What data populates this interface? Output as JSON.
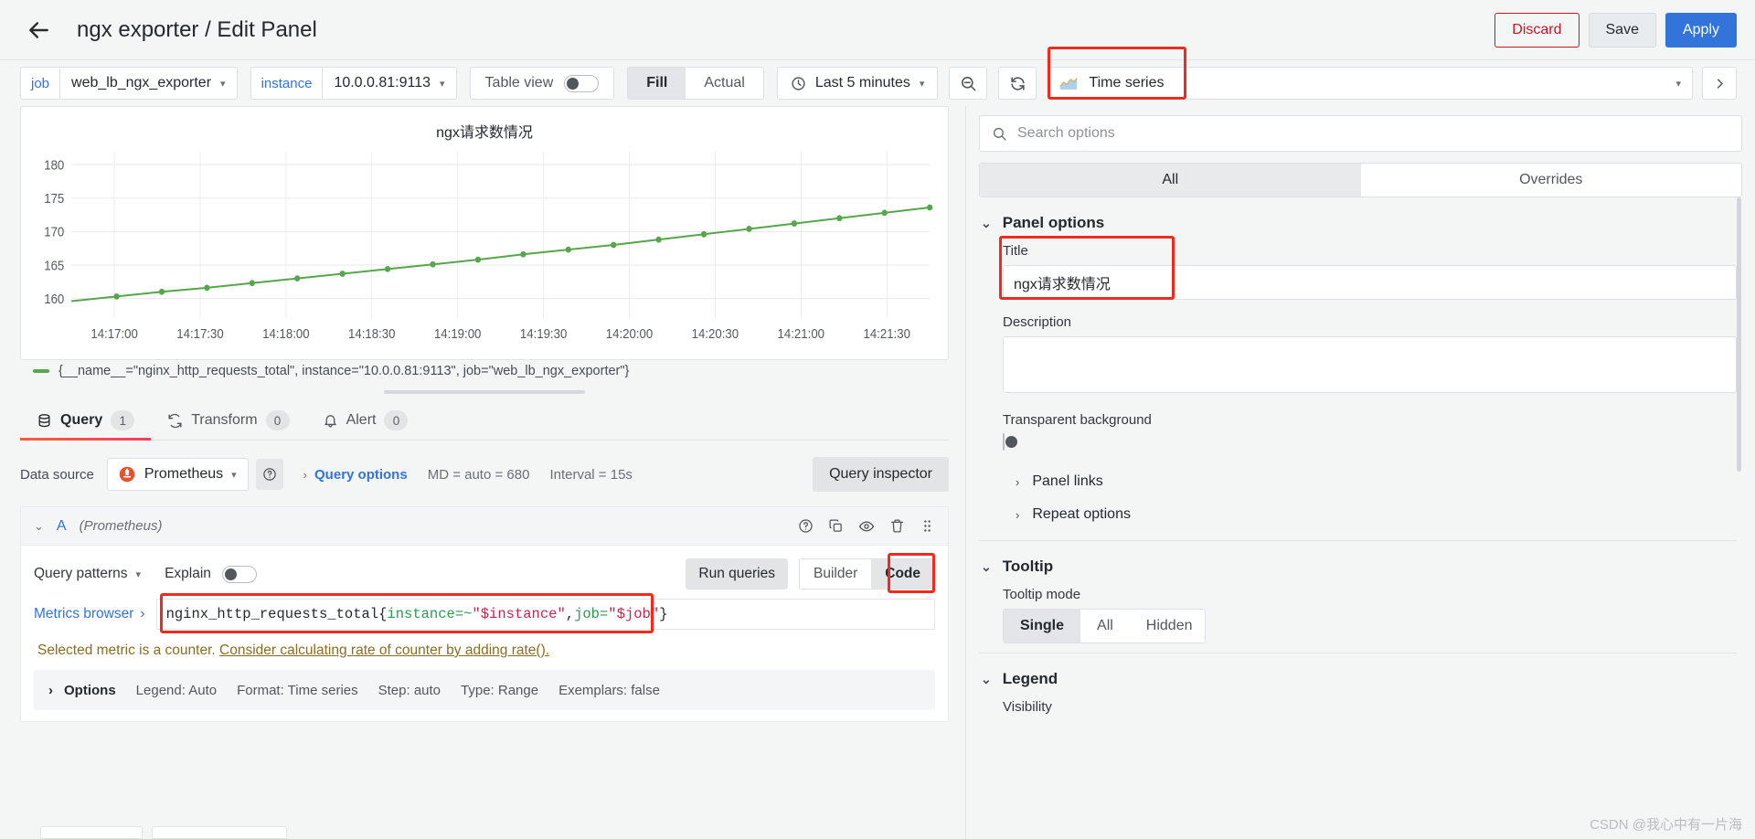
{
  "header": {
    "back_icon": "arrow-left-icon",
    "breadcrumb": "ngx exporter / Edit Panel",
    "discard_label": "Discard",
    "save_label": "Save",
    "apply_label": "Apply"
  },
  "toolbar": {
    "job_label": "job",
    "job_value": "web_lb_ngx_exporter",
    "instance_label": "instance",
    "instance_value": "10.0.0.81:9113",
    "table_view_label": "Table view",
    "table_view_on": false,
    "fill_label": "Fill",
    "actual_label": "Actual",
    "fill_active": true,
    "time_range": "Last 5 minutes",
    "zoom_out_icon": "zoom-out-icon",
    "refresh_icon": "refresh-icon",
    "viz_type": "Time series",
    "viz_icon": "time-series-icon",
    "highlight_color": "#f02a1e"
  },
  "panel": {
    "title": "ngx请求数情况",
    "legend": "{__name__=\"nginx_http_requests_total\", instance=\"10.0.0.81:9113\", job=\"web_lb_ngx_exporter\"}",
    "series_color": "#56A64B"
  },
  "chart_data": {
    "type": "line",
    "title": "ngx请求数情况",
    "xlabel": "",
    "ylabel": "",
    "ylim": [
      157,
      182
    ],
    "yticks": [
      160,
      165,
      170,
      175,
      180
    ],
    "xticks": [
      "14:17:00",
      "14:17:30",
      "14:18:00",
      "14:18:30",
      "14:19:00",
      "14:19:30",
      "14:20:00",
      "14:20:30",
      "14:21:00",
      "14:21:30"
    ],
    "grid": true,
    "legend_position": "bottom",
    "series": [
      {
        "name": "{__name__=\"nginx_http_requests_total\", instance=\"10.0.0.81:9113\", job=\"web_lb_ngx_exporter\"}",
        "color": "#56A64B",
        "x": [
          "14:16:45",
          "14:17:00",
          "14:17:15",
          "14:17:30",
          "14:17:45",
          "14:18:00",
          "14:18:15",
          "14:18:30",
          "14:18:45",
          "14:19:00",
          "14:19:15",
          "14:19:30",
          "14:19:45",
          "14:20:00",
          "14:20:15",
          "14:20:30",
          "14:20:45",
          "14:21:00",
          "14:21:15",
          "14:21:30"
        ],
        "values": [
          159.6,
          160.3,
          161.0,
          161.6,
          162.3,
          163.0,
          163.7,
          164.4,
          165.1,
          165.8,
          166.6,
          167.3,
          168.0,
          168.8,
          169.6,
          170.4,
          171.2,
          172.0,
          172.8,
          173.6
        ]
      }
    ]
  },
  "tabs": [
    {
      "label": "Query",
      "badge": "1",
      "icon": "database-icon",
      "active": true
    },
    {
      "label": "Transform",
      "badge": "0",
      "icon": "transform-icon",
      "active": false
    },
    {
      "label": "Alert",
      "badge": "0",
      "icon": "bell-icon",
      "active": false
    }
  ],
  "query": {
    "datasource_label": "Data source",
    "datasource_value": "Prometheus",
    "datasource_icon": "prometheus-icon",
    "help_icon": "help-circle-icon",
    "query_options_label": "Query options",
    "query_options_meta_md": "MD = auto = 680",
    "query_options_meta_interval": "Interval = 15s",
    "query_inspector_label": "Query inspector",
    "ref_id": "A",
    "ref_datasource": "(Prometheus)",
    "row_actions": [
      "help-circle-icon",
      "copy-icon",
      "eye-icon",
      "trash-icon",
      "drag-handle-icon"
    ],
    "query_patterns_label": "Query patterns",
    "explain_label": "Explain",
    "explain_on": false,
    "run_queries_label": "Run queries",
    "builder_label": "Builder",
    "code_label": "Code",
    "code_active": true,
    "metrics_browser_label": "Metrics browser",
    "expression": {
      "metric": "nginx_http_requests_total",
      "open_brace": "{",
      "label1_key": "instance=~",
      "label1_val": "\"$instance\"",
      "comma": ", ",
      "label2_key": "job=",
      "label2_val": "\"$job\"",
      "close_brace": "}"
    },
    "warning_text": "Selected metric is a counter.",
    "warning_link": "Consider calculating rate of counter by adding rate().",
    "options_label": "Options",
    "options_meta": [
      "Legend: Auto",
      "Format: Time series",
      "Step: auto",
      "Type: Range",
      "Exemplars: false"
    ]
  },
  "sidebar": {
    "search_placeholder": "Search options",
    "tab_all": "All",
    "tab_overrides": "Overrides",
    "panel_options_header": "Panel options",
    "title_label": "Title",
    "title_value": "ngx请求数情况",
    "description_label": "Description",
    "description_value": "",
    "transparent_label": "Transparent background",
    "transparent_on": false,
    "panel_links_label": "Panel links",
    "repeat_options_label": "Repeat options",
    "tooltip_header": "Tooltip",
    "tooltip_mode_label": "Tooltip mode",
    "tooltip_single": "Single",
    "tooltip_all": "All",
    "tooltip_hidden": "Hidden",
    "tooltip_active": "Single",
    "legend_header": "Legend",
    "visibility_label": "Visibility"
  },
  "watermark": "CSDN @我心中有一片海"
}
